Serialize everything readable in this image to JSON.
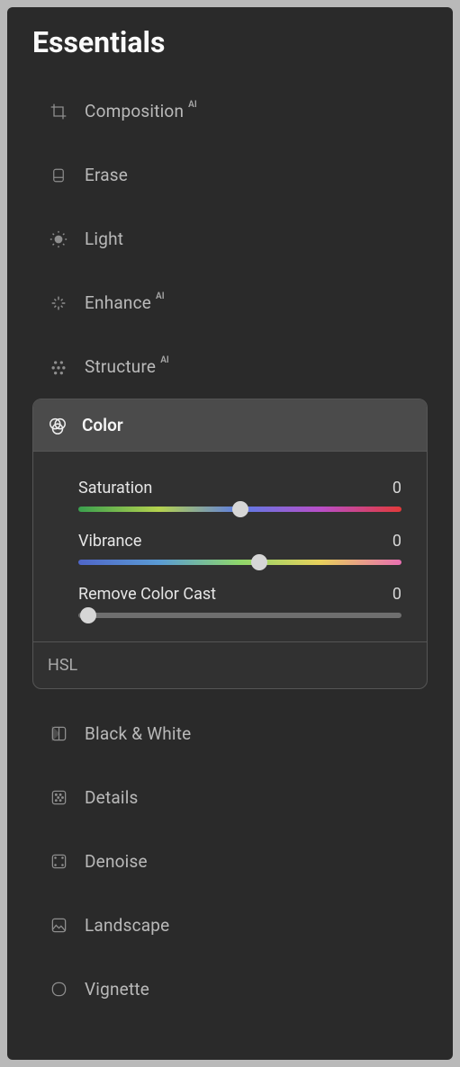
{
  "title": "Essentials",
  "ai_badge": "AI",
  "items": {
    "composition": "Composition",
    "erase": "Erase",
    "light": "Light",
    "enhance": "Enhance",
    "structure": "Structure",
    "color": "Color",
    "black_white": "Black & White",
    "details": "Details",
    "denoise": "Denoise",
    "landscape": "Landscape",
    "vignette": "Vignette"
  },
  "color_panel": {
    "sliders": {
      "saturation": {
        "label": "Saturation",
        "value": "0",
        "thumb_pct": 50
      },
      "vibrance": {
        "label": "Vibrance",
        "value": "0",
        "thumb_pct": 56
      },
      "remove_cc": {
        "label": "Remove Color Cast",
        "value": "0",
        "thumb_pct": 3
      }
    },
    "footer": "HSL"
  }
}
